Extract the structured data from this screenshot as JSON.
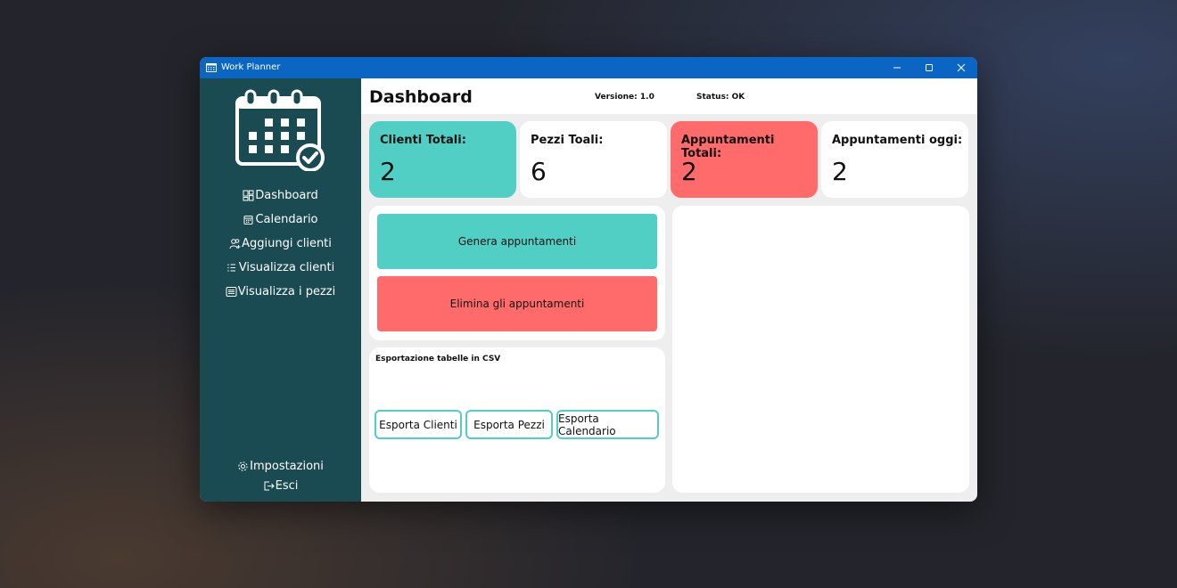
{
  "window": {
    "title": "Work Planner"
  },
  "sidebar": {
    "items": [
      {
        "label": "Dashboard",
        "icon": "dashboard-icon"
      },
      {
        "label": "Calendario",
        "icon": "calendar-icon"
      },
      {
        "label": "Aggiungi clienti",
        "icon": "add-user-icon"
      },
      {
        "label": "Visualizza clienti",
        "icon": "list-icon"
      },
      {
        "label": "Visualizza i pezzi",
        "icon": "table-icon"
      }
    ],
    "bottom": [
      {
        "label": "Impostazioni",
        "icon": "gear-icon"
      },
      {
        "label": "Esci",
        "icon": "logout-icon"
      }
    ]
  },
  "header": {
    "title": "Dashboard",
    "version": "Versione: 1.0",
    "status": "Status: OK"
  },
  "cards": [
    {
      "label": "Clienti Totali:",
      "value": "2",
      "color": "#52cfc4"
    },
    {
      "label": "Pezzi Toali:",
      "value": "6",
      "color": "#ffffff"
    },
    {
      "label": "Appuntamenti Totali:",
      "value": "2",
      "color": "#ff6b6b"
    },
    {
      "label": "Appuntamenti oggi:",
      "value": "2",
      "color": "#ffffff"
    }
  ],
  "actions": {
    "generate_label": "Genera appuntamenti",
    "delete_label": "Elimina gli appuntamenti"
  },
  "export": {
    "title": "Esportazione tabelle in CSV",
    "buttons": [
      "Esporta Clienti",
      "Esporta Pezzi",
      "Esporta Calendario"
    ]
  },
  "colors": {
    "accent_teal": "#52cfc4",
    "accent_red": "#ff6b6b",
    "sidebar_bg": "#1a4a52",
    "titlebar_bg": "#0a66c2"
  }
}
